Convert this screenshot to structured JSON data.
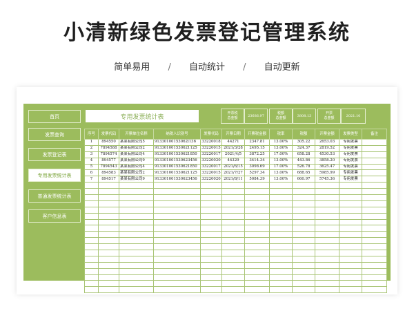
{
  "header": {
    "title": "小清新绿色发票登记管理系统",
    "features": [
      "简单易用",
      "自动统计",
      "自动更新"
    ],
    "separator": "/"
  },
  "nav": [
    {
      "label": "首页",
      "active": false
    },
    {
      "label": "发票查询",
      "active": false
    },
    {
      "label": "发票登记表",
      "active": false
    },
    {
      "label": "专用发票统计表",
      "active": true
    },
    {
      "label": "普通发票统计表",
      "active": false
    },
    {
      "label": "客户信息表",
      "active": false
    }
  ],
  "sheet": {
    "title": "专用发票统计表",
    "stats": [
      {
        "label": "开票税\n总金额",
        "value": "23686.97"
      },
      {
        "label": "税额\n总金额",
        "value": "3808.13"
      },
      {
        "label": "开票\n总金额",
        "value": "2021.10"
      }
    ],
    "columns": [
      "序号",
      "发票代码",
      "开票单位名称",
      "纳税人识别号",
      "发票代码",
      "开票日期",
      "开票税金额",
      "税率",
      "税额",
      "开票金额",
      "发票类型",
      "备注"
    ],
    "rows": [
      [
        "1",
        "894550",
        "某某有限公司5",
        "91330100153062l136",
        "33220018",
        "44271",
        "2347.81",
        "13.00%",
        "305.22",
        "2653.03",
        "专用发票",
        ""
      ],
      [
        "2",
        "7894588",
        "某某有限公司2",
        "913301001530621125",
        "33220015",
        "2021/3/28",
        "2495.15",
        "13.00%",
        "324.37",
        "2819.52",
        "专用发票",
        ""
      ],
      [
        "3",
        "7894574",
        "某某有限公司4",
        "913301001530621850",
        "33220017",
        "2021/4/5",
        "3872.25",
        "17.00%",
        "658.28",
        "4530.53",
        "专用发票",
        ""
      ],
      [
        "4",
        "894577",
        "某某有限公司9",
        "913301001530623456",
        "33220020",
        "44329",
        "3414.34",
        "13.00%",
        "443.86",
        "3858.20",
        "专用发票",
        ""
      ],
      [
        "5",
        "7894543",
        "某某有限公司4",
        "913301001530621850",
        "33220017",
        "2021/6/15",
        "3098.69",
        "17.00%",
        "526.78",
        "3625.47",
        "专用发票",
        ""
      ],
      [
        "6",
        "894583",
        "某某有限公司2",
        "913301001530621125",
        "33220015",
        "2021/7/27",
        "5297.34",
        "13.00%",
        "688.65",
        "5985.99",
        "专用发票",
        ""
      ],
      [
        "7",
        "894517",
        "某某有限公司9",
        "913301001530623456",
        "33220020",
        "2021/8/11",
        "5084.39",
        "13.00%",
        "660.97",
        "5745.36",
        "专用发票",
        ""
      ]
    ]
  }
}
